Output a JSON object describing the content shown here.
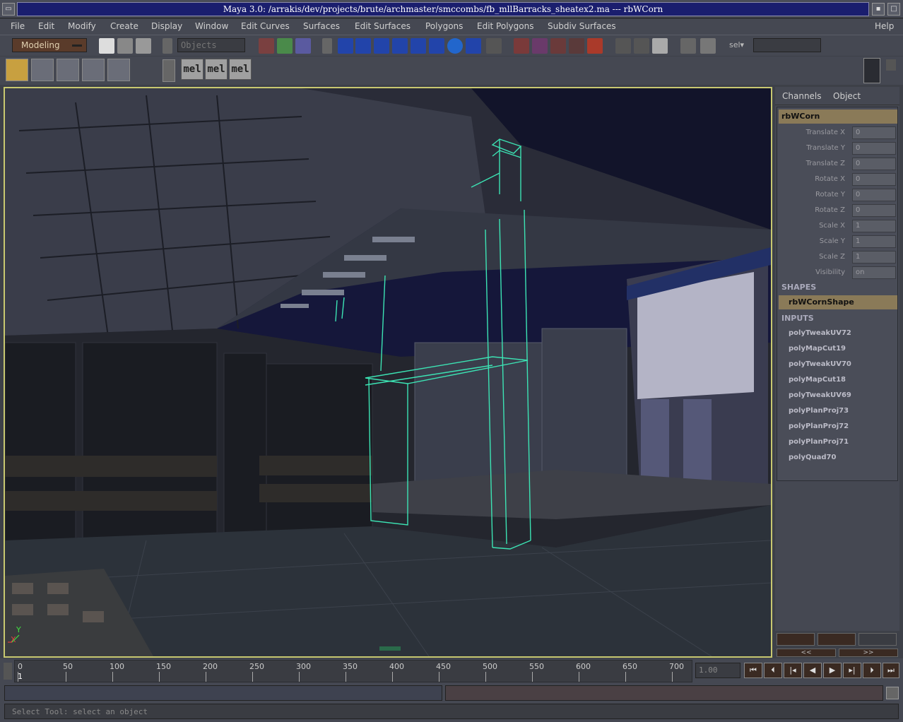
{
  "window": {
    "title": "Maya 3.0: /arrakis/dev/projects/brute/archmaster/smccombs/fb_mllBarracks_sheatex2.ma  ---  rbWCorn"
  },
  "menu": [
    "File",
    "Edit",
    "Modify",
    "Create",
    "Display",
    "Window",
    "Edit Curves",
    "Surfaces",
    "Edit Surfaces",
    "Polygons",
    "Edit Polygons",
    "Subdiv Surfaces"
  ],
  "menu_help": "Help",
  "shelf": {
    "mode": "Modeling",
    "objects_placeholder": "Objects",
    "sel_label": "sel▾"
  },
  "mel_buttons": [
    "mel",
    "mel",
    "mel"
  ],
  "channels": {
    "tab_channels": "Channels",
    "tab_object": "Object",
    "object_name": "rbWCorn",
    "attributes": [
      {
        "label": "Translate X",
        "value": "0"
      },
      {
        "label": "Translate Y",
        "value": "0"
      },
      {
        "label": "Translate Z",
        "value": "0"
      },
      {
        "label": "Rotate X",
        "value": "0"
      },
      {
        "label": "Rotate Y",
        "value": "0"
      },
      {
        "label": "Rotate Z",
        "value": "0"
      },
      {
        "label": "Scale X",
        "value": "1"
      },
      {
        "label": "Scale Y",
        "value": "1"
      },
      {
        "label": "Scale Z",
        "value": "1"
      },
      {
        "label": "Visibility",
        "value": "on"
      }
    ],
    "shapes_header": "SHAPES",
    "shape_name": "rbWCornShape",
    "inputs_header": "INPUTS",
    "inputs": [
      "polyTweakUV72",
      "polyMapCut19",
      "polyTweakUV70",
      "polyMapCut18",
      "polyTweakUV69",
      "polyPlanProj73",
      "polyPlanProj72",
      "polyPlanProj71",
      "polyQuad70"
    ]
  },
  "cb_buttons": {
    "prev": "<<",
    "next": ">>"
  },
  "timeline": {
    "ticks": [
      "0",
      "50",
      "100",
      "150",
      "200",
      "250",
      "300",
      "350",
      "400",
      "450",
      "500",
      "550",
      "600",
      "650",
      "700"
    ],
    "current_marker": "1",
    "current_frame": "1.00"
  },
  "help_line": "Select Tool: select an object",
  "axis": {
    "y": "Y",
    "x": "X"
  }
}
